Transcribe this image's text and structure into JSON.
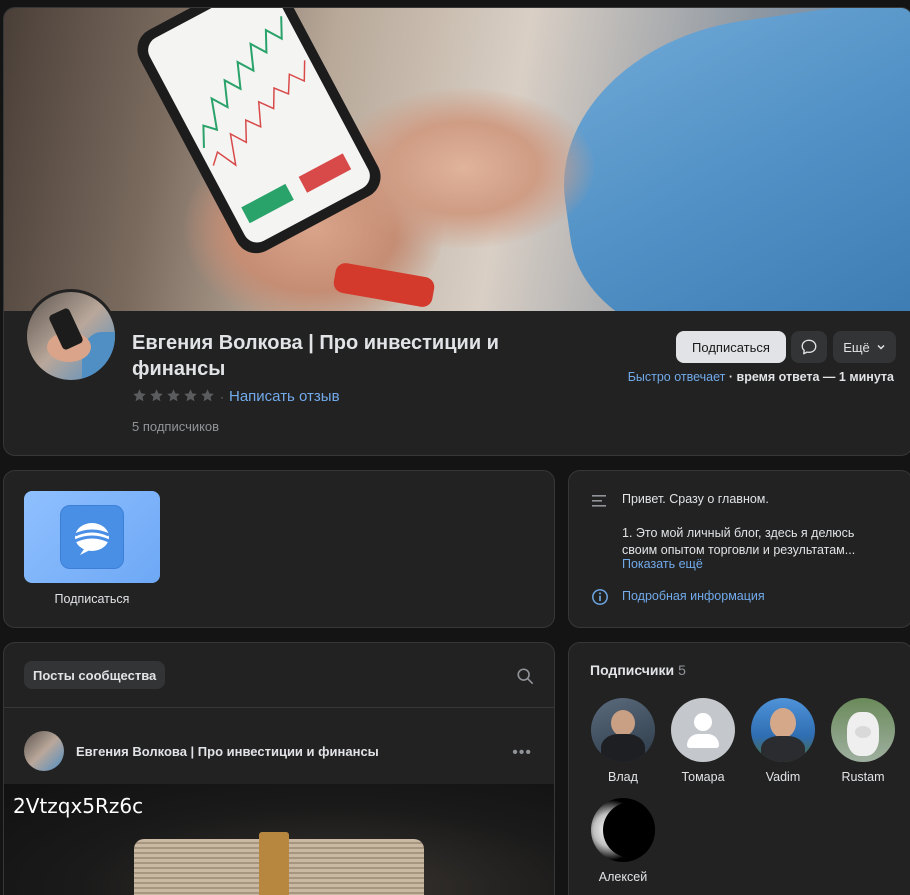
{
  "header": {
    "group_name": "Евгения Волкова | Про инвестиции и финансы",
    "write_review": "Написать отзыв",
    "rating_separator": "·",
    "subscribers": "5 подписчиков",
    "subscribe_button": "Подписаться",
    "more_button": "Ещё",
    "reply_fast": "Быстро отвечает",
    "reply_time": " · время ответа — 1 минута"
  },
  "widget": {
    "label": "Подписаться"
  },
  "about": {
    "line1": "Привет. Сразу о главном.",
    "line2": "1. Это мой личный блог, здесь я делюсь своим опытом торговли и результатам...",
    "show_more": "Показать ещё",
    "details_link": "Подробная информация"
  },
  "posts": {
    "tab_label": "Посты сообщества",
    "post_author": "Евгения Волкова | Про инвестиции и финансы",
    "post_menu": "•••",
    "image_caption": "2Vtzqx5Rz6c"
  },
  "subscribers": {
    "title": "Подписчики",
    "count": "5",
    "items": [
      {
        "name": "Влад"
      },
      {
        "name": "Томара"
      },
      {
        "name": "Vadim"
      },
      {
        "name": "Rustam"
      },
      {
        "name": "Алексей"
      }
    ]
  },
  "colors": {
    "background": "#141414",
    "card": "#222222",
    "accent_link": "#71aaeb",
    "button_light": "#e1e3e6",
    "button_dark": "#333436"
  }
}
